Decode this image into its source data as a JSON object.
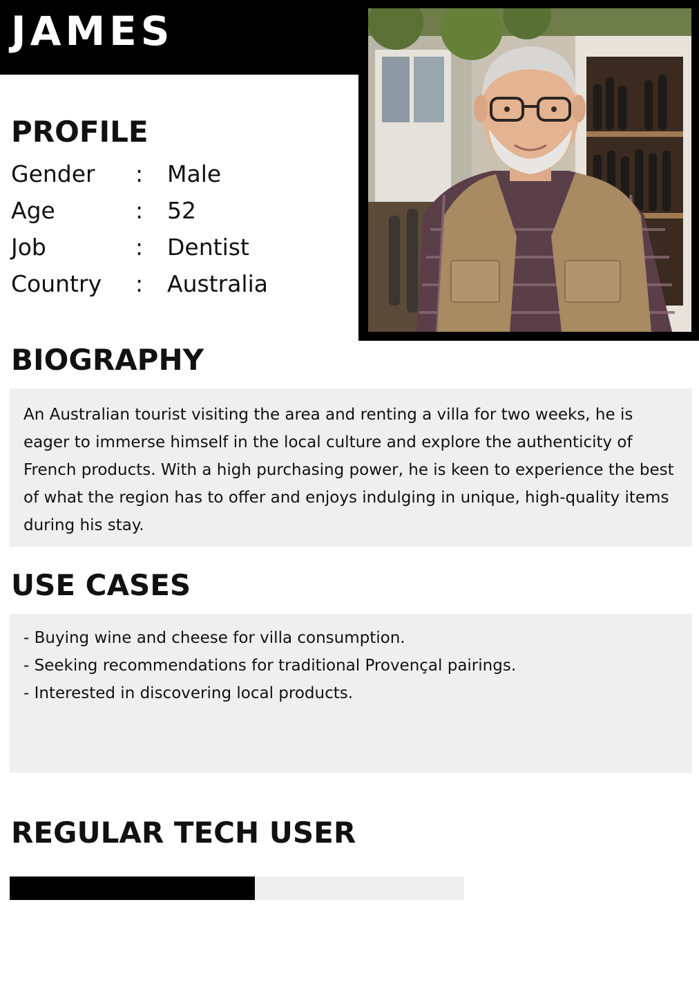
{
  "header": {
    "name": "JAMES"
  },
  "photo": {
    "subject": "older man with glasses, plaid shirt and tan vest in a wine shop"
  },
  "profile": {
    "title": "PROFILE",
    "rows": [
      {
        "label": "Gender",
        "sep": ":",
        "value": "Male"
      },
      {
        "label": "Age",
        "sep": ":",
        "value": "52"
      },
      {
        "label": "Job",
        "sep": ":",
        "value": "Dentist"
      },
      {
        "label": "Country",
        "sep": ":",
        "value": "Australia"
      }
    ]
  },
  "biography": {
    "title": "BIOGRAPHY",
    "text": "An Australian tourist visiting the area and renting a villa for two weeks, he is eager to immerse himself in the local culture and explore the authenticity of French products. With a high purchasing power, he is keen to experience the best of what the region has to offer and enjoys indulging in unique, high-quality items during his stay."
  },
  "use_cases": {
    "title": "USE CASES",
    "items": [
      "- Buying wine and cheese for villa consumption.",
      "- Seeking recommendations for traditional Provençal pairings.",
      "- Interested in discovering local products."
    ]
  },
  "tech": {
    "title": "REGULAR TECH USER",
    "level": 0.54
  },
  "colors": {
    "header_bg": "#000000",
    "box_bg": "#efefef",
    "bar_fill": "#000000",
    "text": "#111111"
  }
}
